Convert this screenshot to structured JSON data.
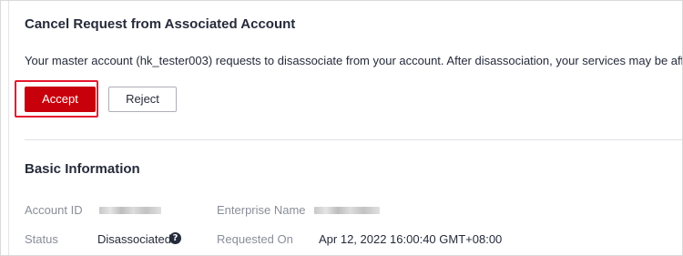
{
  "request": {
    "title": "Cancel Request from Associated Account",
    "message": "Your master account (hk_tester003) requests to disassociate from your account. After disassociation, your services may be affected.",
    "accept_label": "Accept",
    "reject_label": "Reject"
  },
  "basic_info": {
    "title": "Basic Information",
    "fields": {
      "account_id": {
        "label": "Account ID"
      },
      "enterprise_name": {
        "label": "Enterprise Name"
      },
      "status": {
        "label": "Status",
        "value": "Disassociated",
        "help_icon": "question-circle-icon"
      },
      "requested_on": {
        "label": "Requested On",
        "value": "Apr 12, 2022 16:00:40 GMT+08:00"
      }
    }
  },
  "colors": {
    "primary": "#c7000b",
    "highlight": "#e5182e",
    "text": "#252b3a",
    "label": "#8a8e99"
  }
}
